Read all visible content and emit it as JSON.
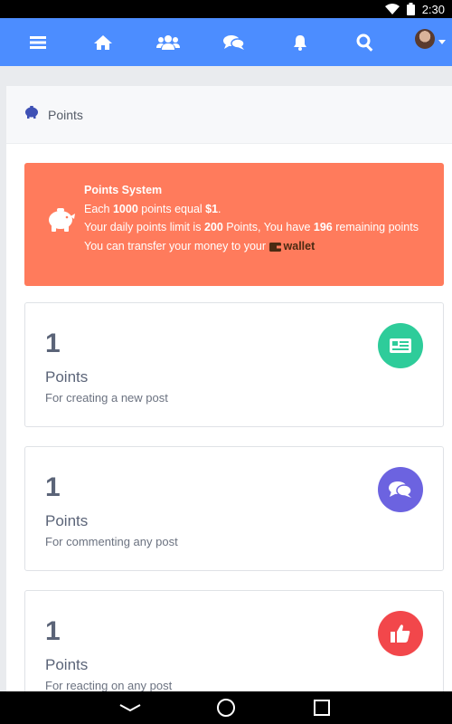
{
  "status_bar": {
    "time": "2:30",
    "icons": [
      "wifi-icon",
      "battery-icon"
    ]
  },
  "navbar": {
    "color": "#4c8dff",
    "items": [
      "menu-icon",
      "home-icon",
      "users-icon",
      "chat-icon",
      "bell-icon",
      "search-icon",
      "avatar"
    ]
  },
  "breadcrumb": {
    "icon": "piggy-bank-icon",
    "label": "Points"
  },
  "banner": {
    "color": "#ff7b5c",
    "title": "Points System",
    "line1_pre": "Each ",
    "line1_points": "1000",
    "line1_mid": " points equal ",
    "line1_amount": "$1",
    "line1_post": ".",
    "line2_pre": "Your daily points limit is ",
    "line2_limit": "200",
    "line2_mid": " Points, You have ",
    "line2_remaining": "196",
    "line2_post": " remaining points",
    "line3_pre": "You can transfer your money to your ",
    "line3_link": "wallet"
  },
  "point_cards": [
    {
      "value": "1",
      "label": "Points",
      "description": "For creating a new post",
      "icon": "news-icon",
      "color": "#2ecc9a"
    },
    {
      "value": "1",
      "label": "Points",
      "description": "For commenting any post",
      "icon": "comments-icon",
      "color": "#6c63e0"
    },
    {
      "value": "1",
      "label": "Points",
      "description": "For reacting on any post",
      "icon": "thumbs-up-icon",
      "color": "#f2474b"
    }
  ],
  "system_nav": [
    "back-icon",
    "home-circle-icon",
    "recents-icon"
  ]
}
